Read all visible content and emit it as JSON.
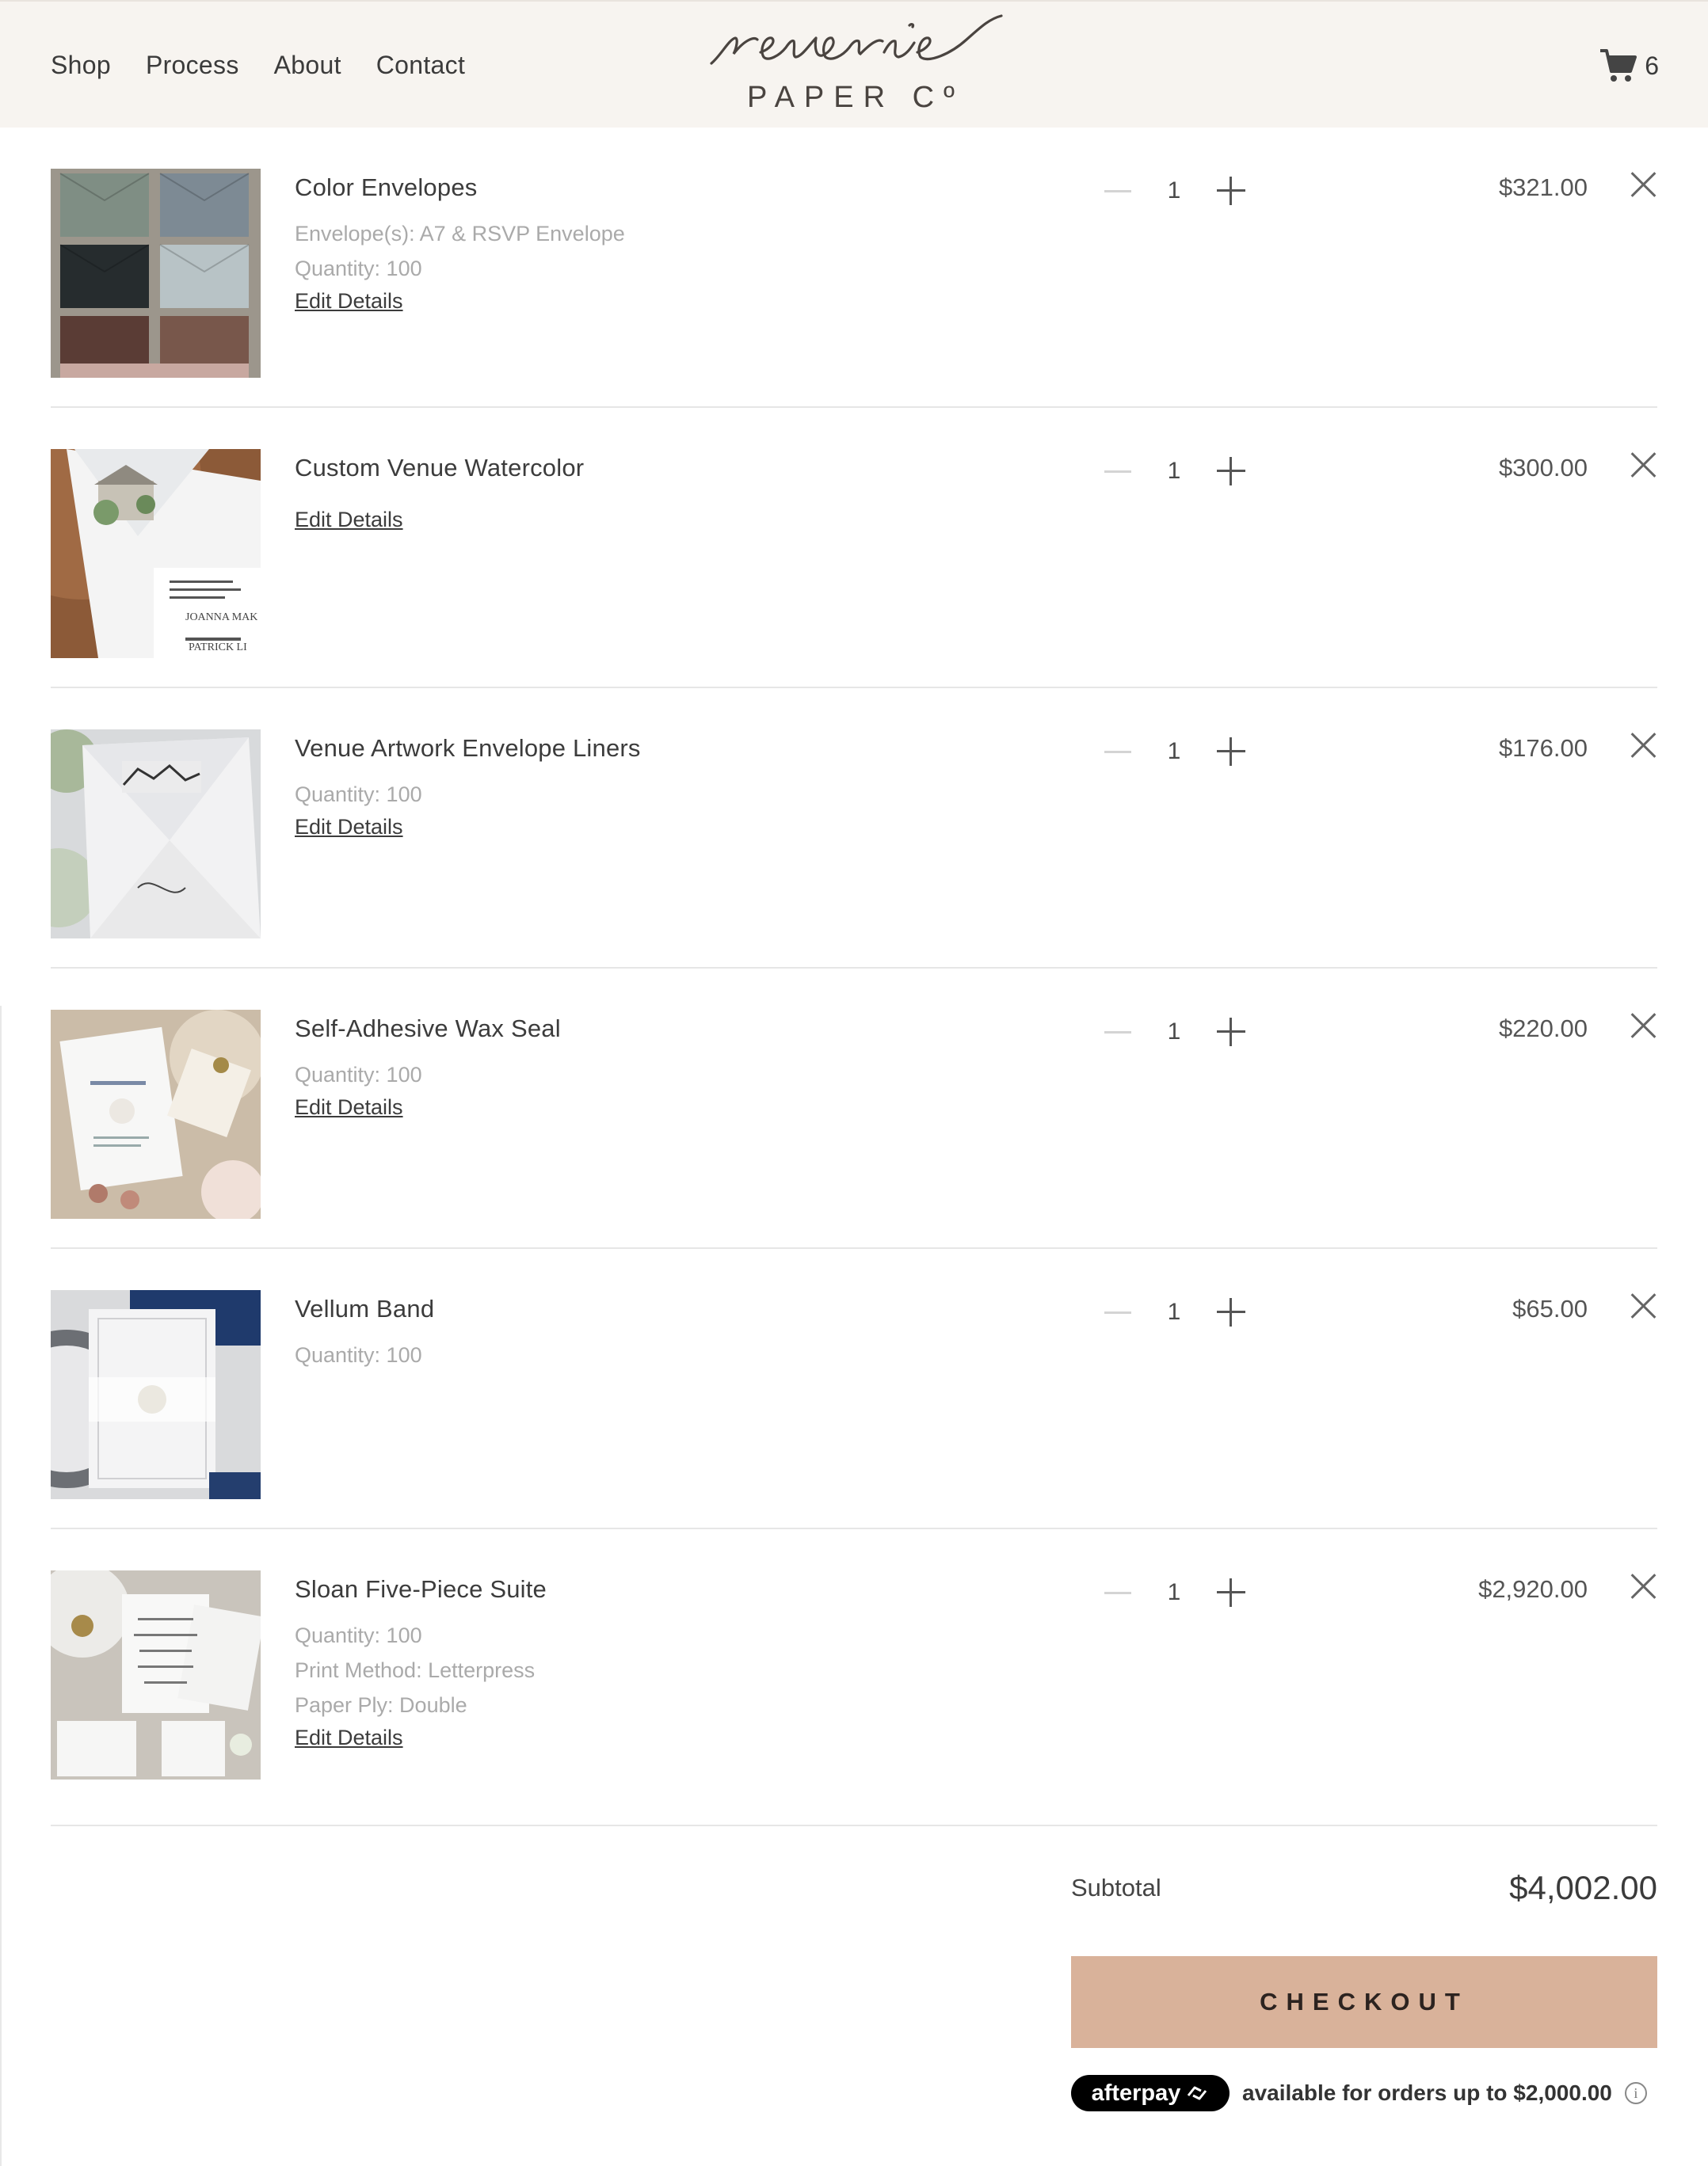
{
  "header": {
    "nav": [
      "Shop",
      "Process",
      "About",
      "Contact"
    ],
    "logo_script": "reverie",
    "logo_sub": "PAPER Cº",
    "cart_count": "6"
  },
  "items": [
    {
      "title": "Color Envelopes",
      "meta": [
        "Envelope(s): A7 & RSVP Envelope",
        "Quantity: 100"
      ],
      "edit": "Edit Details",
      "qty": "1",
      "price": "$321.00"
    },
    {
      "title": "Custom Venue Watercolor",
      "meta": [],
      "edit": "Edit Details",
      "qty": "1",
      "price": "$300.00"
    },
    {
      "title": "Venue Artwork Envelope Liners",
      "meta": [
        "Quantity: 100"
      ],
      "edit": "Edit Details",
      "qty": "1",
      "price": "$176.00"
    },
    {
      "title": "Self-Adhesive Wax Seal",
      "meta": [
        "Quantity: 100"
      ],
      "edit": "Edit Details",
      "qty": "1",
      "price": "$220.00"
    },
    {
      "title": "Vellum Band",
      "meta": [
        "Quantity: 100"
      ],
      "edit": "",
      "qty": "1",
      "price": "$65.00"
    },
    {
      "title": "Sloan Five-Piece Suite",
      "meta": [
        "Quantity: 100",
        "Print Method: Letterpress",
        "Paper Ply: Double"
      ],
      "edit": "Edit Details",
      "qty": "1",
      "price": "$2,920.00"
    }
  ],
  "summary": {
    "subtotal_label": "Subtotal",
    "subtotal_value": "$4,002.00",
    "checkout_label": "CHECKOUT",
    "afterpay_brand": "afterpay",
    "afterpay_text": "available for orders up to $2,000.00",
    "info_glyph": "i"
  },
  "colors": {
    "header_bg": "#f7f4f0",
    "checkout_bg": "#d9b29a",
    "afterpay_bg": "#000000"
  }
}
